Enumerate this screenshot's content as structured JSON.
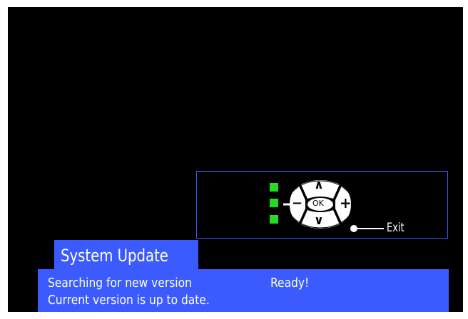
{
  "remote": {
    "ok_label": "OK",
    "up_symbol": "∧",
    "down_symbol": "∨",
    "minus_symbol": "−",
    "plus_symbol": "+",
    "exit_label": "Exit"
  },
  "dialog": {
    "title": "System Update",
    "status_label": "Searching for new version",
    "status_value": "Ready!",
    "message": "Current version is up to date."
  },
  "colors": {
    "accent": "#3b5bff",
    "background": "#000000",
    "led": "#22dd22",
    "text": "#ffffff"
  }
}
